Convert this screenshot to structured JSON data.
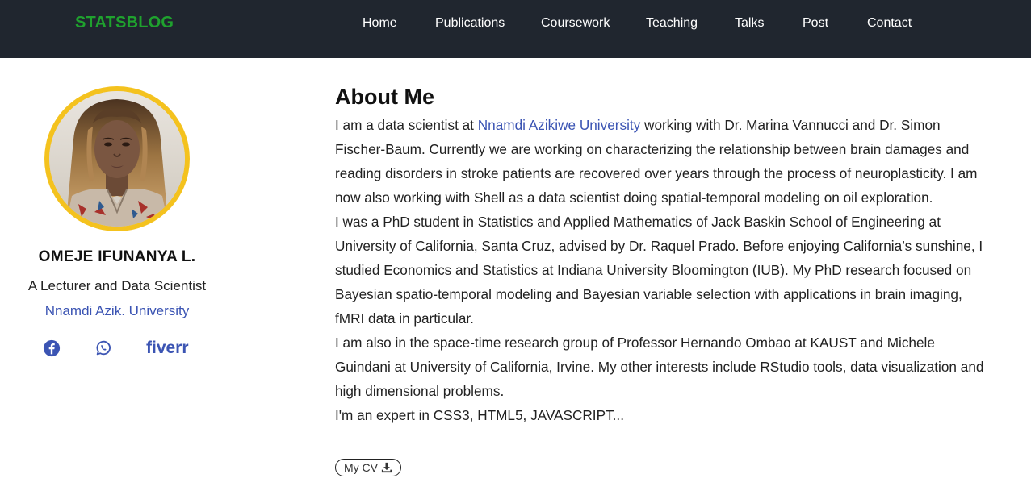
{
  "site": {
    "brand": "STATSBLOG",
    "nav": [
      "Home",
      "Publications",
      "Coursework",
      "Teaching",
      "Talks",
      "Post",
      "Contact"
    ]
  },
  "author": {
    "name": "OMEJE IFUNANYA L.",
    "bio": "A Lecturer and Data Scientist",
    "organization": "Nnamdi Azik. University",
    "social": {
      "facebook_icon": "facebook-icon",
      "whatsapp_icon": "whatsapp-icon",
      "fiverr_label": "fiverr"
    }
  },
  "main": {
    "title": "About Me",
    "p1_before": "I am a data scientist at ",
    "p1_link": "Nnamdi Azikiwe University",
    "p1_after": " working with Dr. Marina Vannucci and Dr. Simon Fischer-Baum. Currently we are working on characterizing the relationship between brain damages and reading disorders in stroke patients are recovered over years through the process of neuroplasticity. I am now also working with Shell as a data scientist doing spatial-temporal modeling on oil exploration.",
    "p2": "I was a PhD student in Statistics and Applied Mathematics of Jack Baskin School of Engineering at University of California, Santa Cruz, advised by Dr. Raquel Prado. Before enjoying California’s sunshine, I studied Economics and Statistics at Indiana University Bloomington (IUB). My PhD research focused on Bayesian spatio-temporal modeling and Bayesian variable selection with applications in brain imaging, fMRI data in particular.",
    "p3": "I am also in the space-time research group of Professor Hernando Ombao at KAUST and Michele Guindani at University of California, Irvine. My other interests include RStudio tools, data visualization and high dimensional problems.",
    "p4": "I'm an expert in CSS3, HTML5, JAVASCRIPT...",
    "cv_label": "My CV",
    "cv_icon": "download-icon"
  },
  "colors": {
    "navbar_bg": "#20262f",
    "brand": "#1fa22e",
    "link": "#3b54b3",
    "avatar_ring": "#f4c21e"
  }
}
